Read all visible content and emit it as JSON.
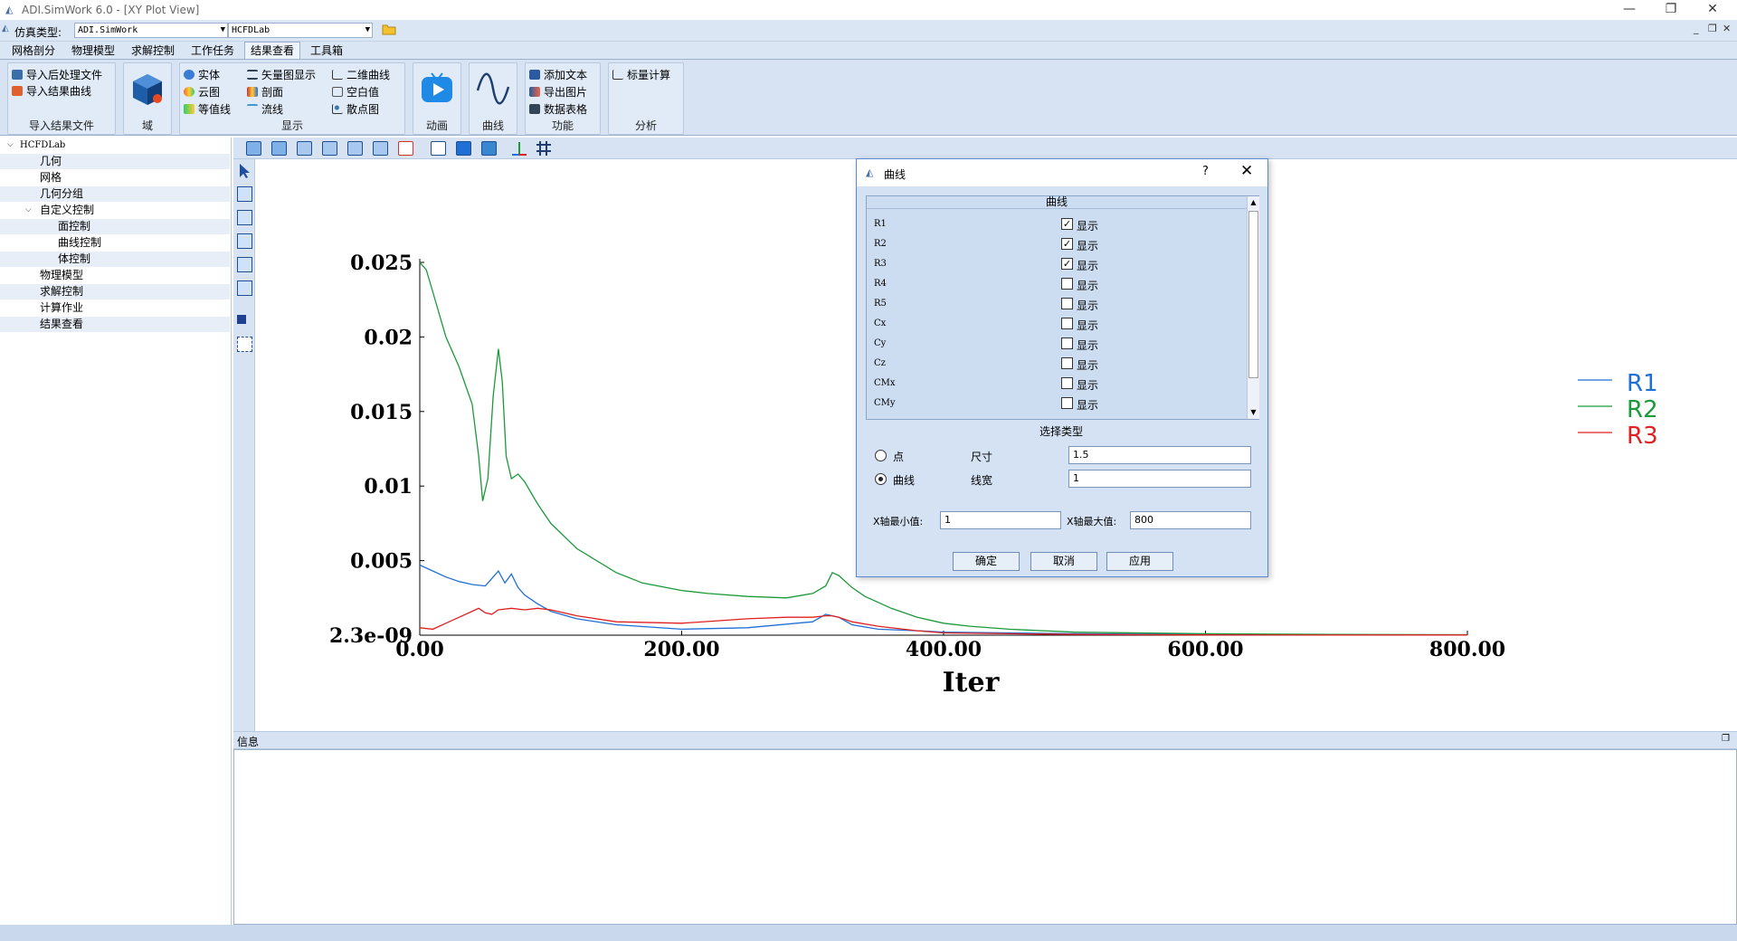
{
  "window": {
    "title": "ADI.SimWork 6.0 - [XY Plot View]",
    "minimize": "—",
    "restore": "❐",
    "close": "✕"
  },
  "toprow": {
    "sim_type_label": "仿真类型:",
    "sim_type_value": "ADI.SimWork",
    "project_value": "HCFDLab",
    "mdi_min": "_",
    "mdi_restore": "❐",
    "mdi_close": "✕"
  },
  "tabs": [
    "网格剖分",
    "物理模型",
    "求解控制",
    "工作任务",
    "结果查看",
    "工具箱"
  ],
  "active_tab": "结果查看",
  "ribbon": {
    "import": {
      "title": "导入结果文件",
      "items": [
        "导入后处理文件",
        "导入结果曲线"
      ]
    },
    "domain": {
      "title": "域"
    },
    "display": {
      "title": "显示",
      "col1": [
        "实体",
        "云图",
        "等值线"
      ],
      "col2": [
        "矢量图显示",
        "剖面",
        "流线"
      ],
      "col3": [
        "二维曲线",
        "空白值",
        "散点图"
      ]
    },
    "animation": {
      "title": "动画"
    },
    "curve": {
      "title": "曲线"
    },
    "function": {
      "title": "功能",
      "items": [
        "添加文本",
        "导出图片",
        "数据表格"
      ]
    },
    "analysis": {
      "title": "分析",
      "items": [
        "标量计算"
      ]
    }
  },
  "tree": {
    "root": "HCFDLab",
    "items": [
      "几何",
      "网格",
      "几何分组",
      "自定义控制",
      "面控制",
      "曲线控制",
      "体控制",
      "物理模型",
      "求解控制",
      "计算作业",
      "结果查看"
    ]
  },
  "info": {
    "title": "信息"
  },
  "chart_data": {
    "type": "line",
    "xlabel": "Iter",
    "ylabel": "",
    "xlim": [
      0,
      800
    ],
    "ylim": [
      2.3e-09,
      0.025
    ],
    "x_ticks": [
      "0.00",
      "200.00",
      "400.00",
      "600.00",
      "800.00"
    ],
    "y_ticks": [
      "2.3e-09",
      "0.005",
      "0.01",
      "0.015",
      "0.02",
      "0.025"
    ],
    "legend_position": "right",
    "grid": false,
    "series": [
      {
        "name": "R1",
        "color": "#1f6fd6",
        "x": [
          0,
          10,
          20,
          30,
          40,
          50,
          55,
          60,
          65,
          70,
          75,
          80,
          90,
          100,
          120,
          150,
          200,
          250,
          300,
          310,
          320,
          330,
          350,
          380,
          400,
          450,
          500,
          600,
          700,
          800
        ],
        "y": [
          0.0047,
          0.0043,
          0.0039,
          0.0036,
          0.0034,
          0.0033,
          0.0038,
          0.0043,
          0.0035,
          0.0041,
          0.0032,
          0.0027,
          0.0021,
          0.0016,
          0.0011,
          0.0007,
          0.0004,
          0.0005,
          0.0009,
          0.0014,
          0.0012,
          0.0007,
          0.0004,
          0.0003,
          0.0002,
          0.00015,
          0.0001,
          5e-05,
          2e-05,
          1e-05
        ]
      },
      {
        "name": "R2",
        "color": "#1a9a3a",
        "x": [
          0,
          5,
          10,
          20,
          30,
          40,
          45,
          48,
          52,
          56,
          60,
          63,
          66,
          70,
          75,
          80,
          90,
          100,
          120,
          150,
          170,
          200,
          220,
          250,
          280,
          300,
          310,
          315,
          320,
          330,
          340,
          350,
          360,
          380,
          400,
          420,
          450,
          500,
          600,
          700,
          800
        ],
        "y": [
          0.025,
          0.0245,
          0.023,
          0.02,
          0.018,
          0.0155,
          0.012,
          0.009,
          0.0105,
          0.016,
          0.0192,
          0.017,
          0.012,
          0.0105,
          0.0108,
          0.0103,
          0.0088,
          0.0075,
          0.0058,
          0.0042,
          0.0035,
          0.003,
          0.0028,
          0.0026,
          0.0025,
          0.0028,
          0.0033,
          0.0042,
          0.004,
          0.0032,
          0.0026,
          0.0022,
          0.0018,
          0.0012,
          0.0008,
          0.0006,
          0.0004,
          0.0002,
          0.0001,
          5e-05,
          3e-05
        ]
      },
      {
        "name": "R3",
        "color": "#e02020",
        "x": [
          0,
          10,
          20,
          30,
          40,
          45,
          50,
          55,
          60,
          70,
          80,
          90,
          100,
          120,
          150,
          200,
          250,
          280,
          300,
          310,
          315,
          320,
          330,
          350,
          380,
          400,
          450,
          500,
          600,
          700,
          800
        ],
        "y": [
          0.0005,
          0.0004,
          0.0008,
          0.0012,
          0.0016,
          0.0018,
          0.0015,
          0.0014,
          0.0017,
          0.0018,
          0.0017,
          0.0018,
          0.0017,
          0.0013,
          0.0009,
          0.0008,
          0.0011,
          0.0012,
          0.0012,
          0.0013,
          0.0013,
          0.0012,
          0.0009,
          0.0006,
          0.0003,
          0.00015,
          0.0001,
          5e-05,
          2e-05,
          1e-05,
          1e-05
        ]
      }
    ]
  },
  "dialog": {
    "title": "曲线",
    "help": "?",
    "close": "✕",
    "curves_header": "曲线",
    "curves": [
      {
        "name": "R1",
        "label": "显示",
        "checked": true
      },
      {
        "name": "R2",
        "label": "显示",
        "checked": true
      },
      {
        "name": "R3",
        "label": "显示",
        "checked": true
      },
      {
        "name": "R4",
        "label": "显示",
        "checked": false
      },
      {
        "name": "R5",
        "label": "显示",
        "checked": false
      },
      {
        "name": "Cx",
        "label": "显示",
        "checked": false
      },
      {
        "name": "Cy",
        "label": "显示",
        "checked": false
      },
      {
        "name": "Cz",
        "label": "显示",
        "checked": false
      },
      {
        "name": "CMx",
        "label": "显示",
        "checked": false
      },
      {
        "name": "CMy",
        "label": "显示",
        "checked": false
      }
    ],
    "select_type_label": "选择类型",
    "point_label": "点",
    "curve_label": "曲线",
    "size_label": "尺寸",
    "size_value": "1.5",
    "linewidth_label": "线宽",
    "linewidth_value": "1",
    "xmin_label": "X轴最小值:",
    "xmin_value": "1",
    "xmax_label": "X轴最大值:",
    "xmax_value": "800",
    "ok": "确定",
    "cancel": "取消",
    "apply": "应用"
  }
}
